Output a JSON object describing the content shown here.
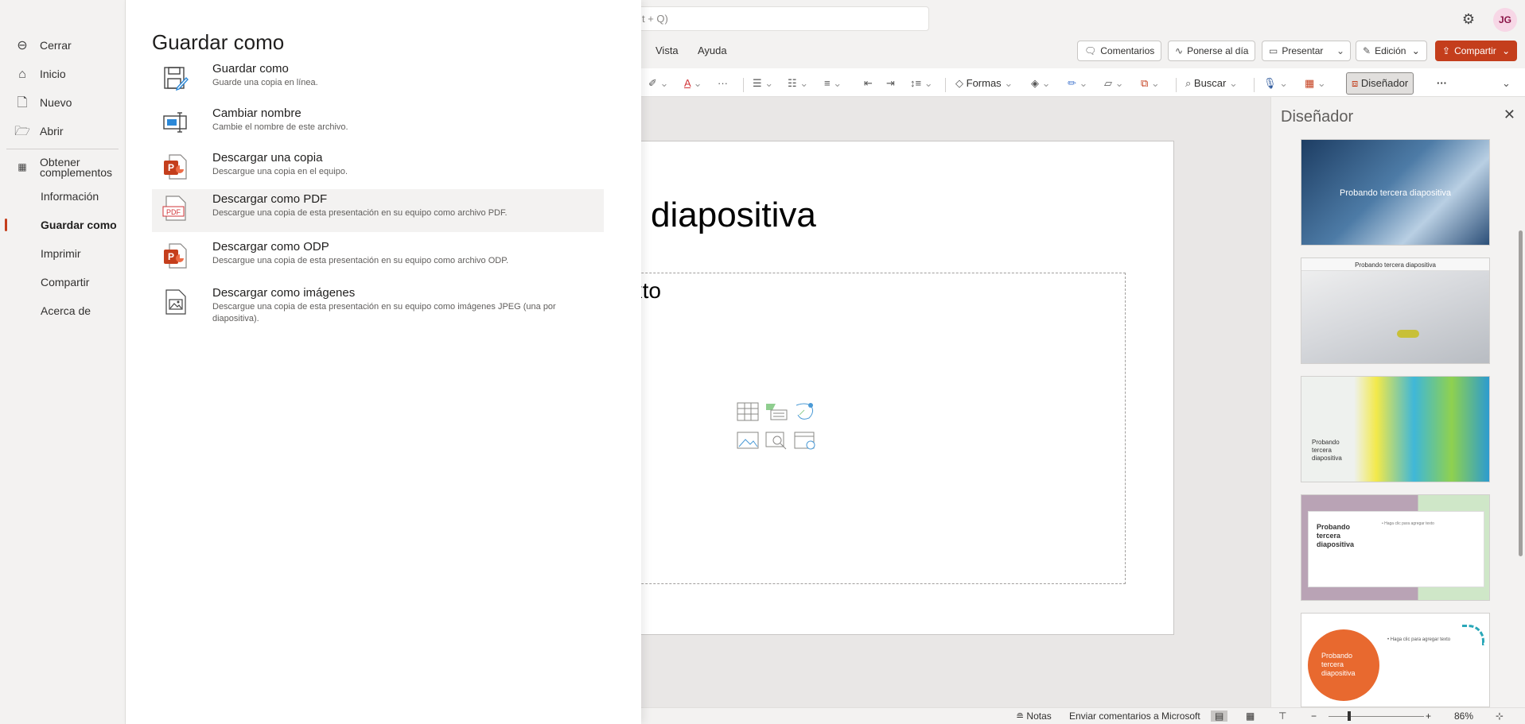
{
  "search": {
    "placeholder": "t + Q)"
  },
  "user": {
    "initials": "JG"
  },
  "menu": {
    "tabs": [
      "Vista",
      "Ayuda"
    ]
  },
  "actions": {
    "comments": "Comentarios",
    "catch_up": "Ponerse al día",
    "present": "Presentar",
    "editing": "Edición",
    "share": "Compartir"
  },
  "ribbon": {
    "shapes": "Formas",
    "find": "Buscar",
    "designer": "Diseñador",
    "more": "···"
  },
  "slide": {
    "title": "diapositiva",
    "body": "exto"
  },
  "designer": {
    "title": "Diseñador",
    "thumbs": [
      {
        "text": "Probando tercera diapositiva"
      },
      {
        "text": "Probando tercera diapositiva"
      },
      {
        "text": "Probando tercera diapositiva"
      },
      {
        "text": "Probando tercera diapositiva",
        "sub": "• Haga clic para agregar texto"
      },
      {
        "text": "Probando tercera diapositiva",
        "sub": "• Haga clic para agregar texto"
      }
    ]
  },
  "status": {
    "notes": "Notas",
    "feedback": "Enviar comentarios a Microsoft",
    "zoom": "86%"
  },
  "backstage": {
    "nav": {
      "close": "Cerrar",
      "home": "Inicio",
      "new": "Nuevo",
      "open": "Abrir",
      "addins": "Obtener complementos",
      "info": "Información",
      "save_as": "Guardar como",
      "print": "Imprimir",
      "share": "Compartir",
      "about": "Acerca de"
    },
    "title": "Guardar como",
    "options": [
      {
        "title": "Guardar como",
        "desc": "Guarde una copia en línea."
      },
      {
        "title": "Cambiar nombre",
        "desc": "Cambie el nombre de este archivo."
      },
      {
        "title": "Descargar una copia",
        "desc": "Descargue una copia en el equipo."
      },
      {
        "title": "Descargar como PDF",
        "desc": "Descargue una copia de esta presentación en su equipo como archivo PDF."
      },
      {
        "title": "Descargar como ODP",
        "desc": "Descargue una copia de esta presentación en su equipo como archivo ODP."
      },
      {
        "title": "Descargar como imágenes",
        "desc": "Descargue una copia de esta presentación en su equipo como imágenes JPEG (una por diapositiva)."
      }
    ]
  }
}
